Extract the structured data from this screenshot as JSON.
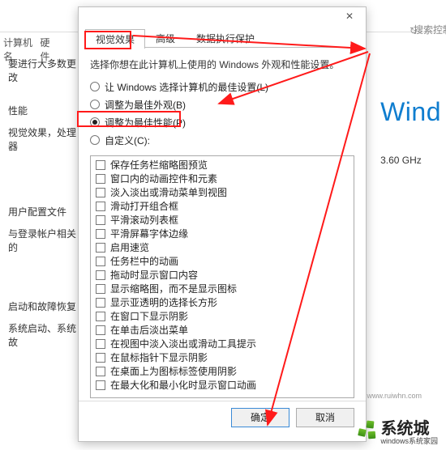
{
  "bg": {
    "search_placeholder": "搜索控制面",
    "tabs": {
      "t1": "计算机名",
      "t2": "硬件"
    },
    "heading": "要进行大多数更改",
    "groups": {
      "perf": {
        "title": "性能",
        "sub": "视觉效果，处理器"
      },
      "profile": {
        "title": "用户配置文件",
        "sub": "与登录帐户相关的"
      },
      "startup": {
        "title": "启动和故障恢复",
        "sub": "系统启动、系统故"
      }
    },
    "wind": "Wind",
    "ghz": "3.60 GHz"
  },
  "dlg": {
    "close_glyph": "✕",
    "tabs": {
      "t1": "视觉效果",
      "t2": "高级",
      "t3": "数据执行保护"
    },
    "desc": "选择你想在此计算机上使用的 Windows 外观和性能设置。",
    "radios": {
      "r1": "让 Windows 选择计算机的最佳设置(L)",
      "r2": "调整为最佳外观(B)",
      "r3": "调整为最佳性能(P)",
      "r4": "自定义(C):"
    },
    "options": [
      "保存任务栏缩略图预览",
      "窗口内的动画控件和元素",
      "淡入淡出或滑动菜单到视图",
      "滑动打开组合框",
      "平滑滚动列表框",
      "平滑屏幕字体边缘",
      "启用速览",
      "任务栏中的动画",
      "拖动时显示窗口内容",
      "显示缩略图，而不是显示图标",
      "显示亚透明的选择长方形",
      "在窗口下显示阴影",
      "在单击后淡出菜单",
      "在视图中淡入淡出或滑动工具提示",
      "在鼠标指针下显示阴影",
      "在桌面上为图标标签使用阴影",
      "在最大化和最小化时显示窗口动画"
    ],
    "buttons": {
      "ok": "确定",
      "cancel": "取消"
    }
  },
  "watermark": {
    "title": "系统城",
    "sub": "windows系统家园",
    "url": "www.ruiwhn.com"
  }
}
